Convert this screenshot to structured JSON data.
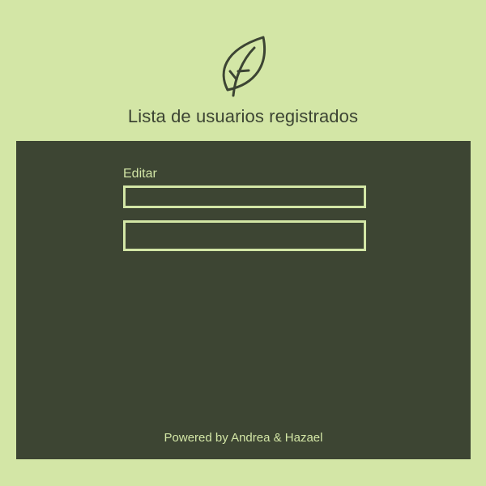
{
  "header": {
    "logo_icon": "leaf-icon",
    "title": "Lista de usuarios registrados"
  },
  "form": {
    "label": "Editar",
    "field1": {
      "value": "",
      "placeholder": ""
    },
    "field2": {
      "value": "",
      "placeholder": ""
    }
  },
  "footer": {
    "text": "Powered by Andrea & Hazael"
  },
  "colors": {
    "background": "#d3e6a6",
    "panel": "#3d4533",
    "accent": "#d3e6a6",
    "title_text": "#3c4433"
  }
}
